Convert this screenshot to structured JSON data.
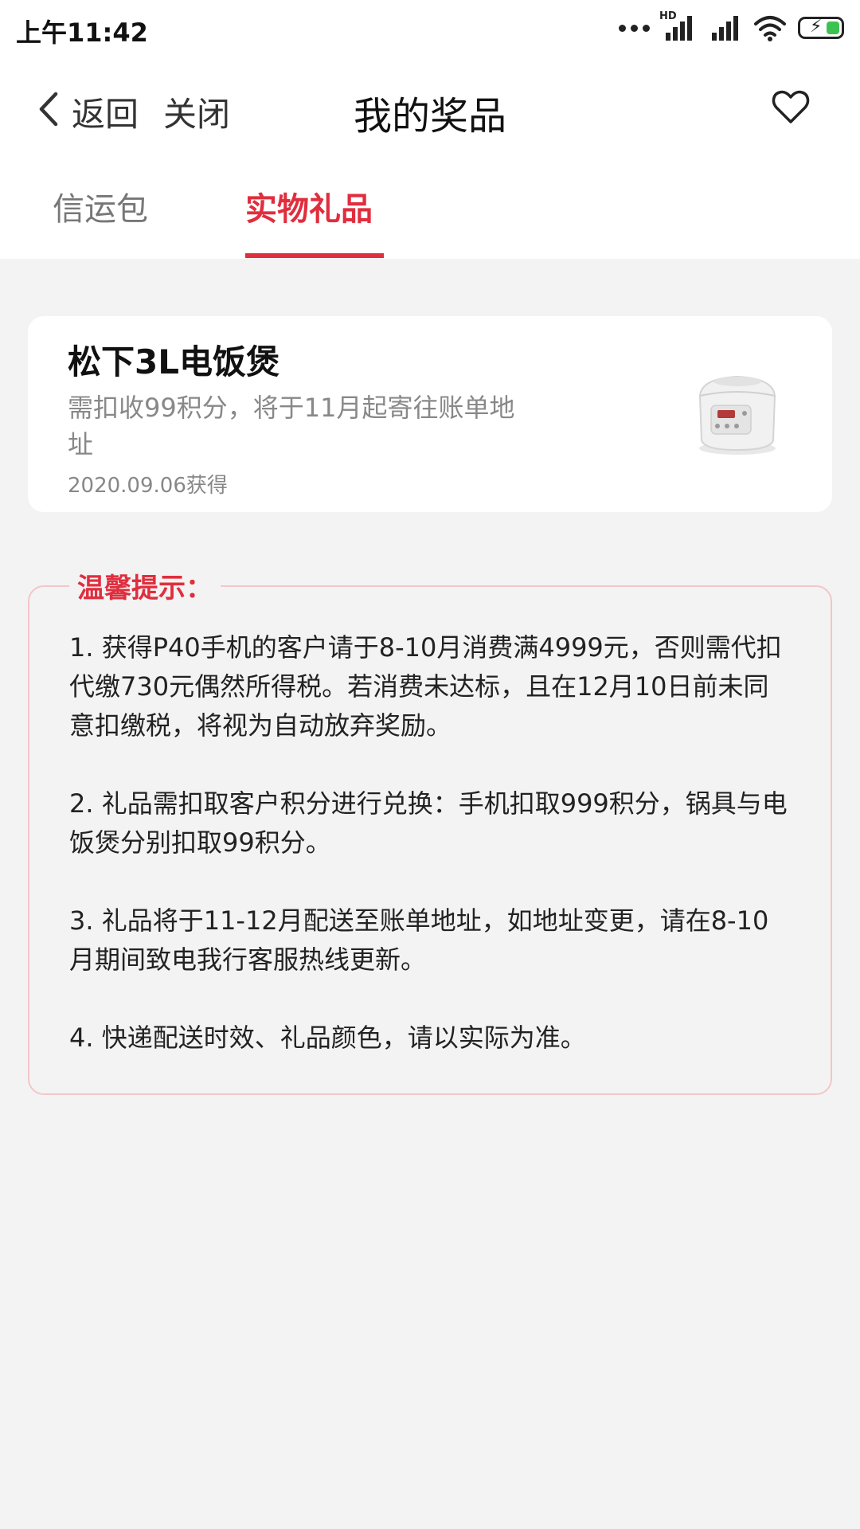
{
  "status_bar": {
    "time": "上午11:42",
    "network": "HD"
  },
  "nav": {
    "back_label": "返回",
    "close_label": "关闭",
    "title": "我的奖品"
  },
  "tabs": [
    {
      "label": "信运包"
    },
    {
      "label": "实物礼品"
    }
  ],
  "prize": {
    "title": "松下3L电饭煲",
    "description": "需扣收99积分，将于11月起寄往账单地址",
    "date": "2020.09.06获得"
  },
  "tips": {
    "title": "温馨提示：",
    "items": [
      "1. 获得P40手机的客户请于8-10月消费满4999元，否则需代扣代缴730元偶然所得税。若消费未达标，且在12月10日前未同意扣缴税，将视为自动放弃奖励。",
      "2. 礼品需扣取客户积分进行兑换：手机扣取999积分，锅具与电饭煲分别扣取99积分。",
      "3. 礼品将于11-12月配送至账单地址，如地址变更，请在8-10月期间致电我行客服热线更新。",
      "4. 快递配送时效、礼品颜色，请以实际为准。"
    ]
  },
  "colors": {
    "accent": "#e02e3e",
    "background": "#f3f3f3",
    "tips_border": "#f3c6c9"
  },
  "icons": [
    "back-chevron-icon",
    "heart-icon",
    "signal-icon",
    "wifi-icon",
    "battery-icon",
    "rice-cooker-image"
  ]
}
